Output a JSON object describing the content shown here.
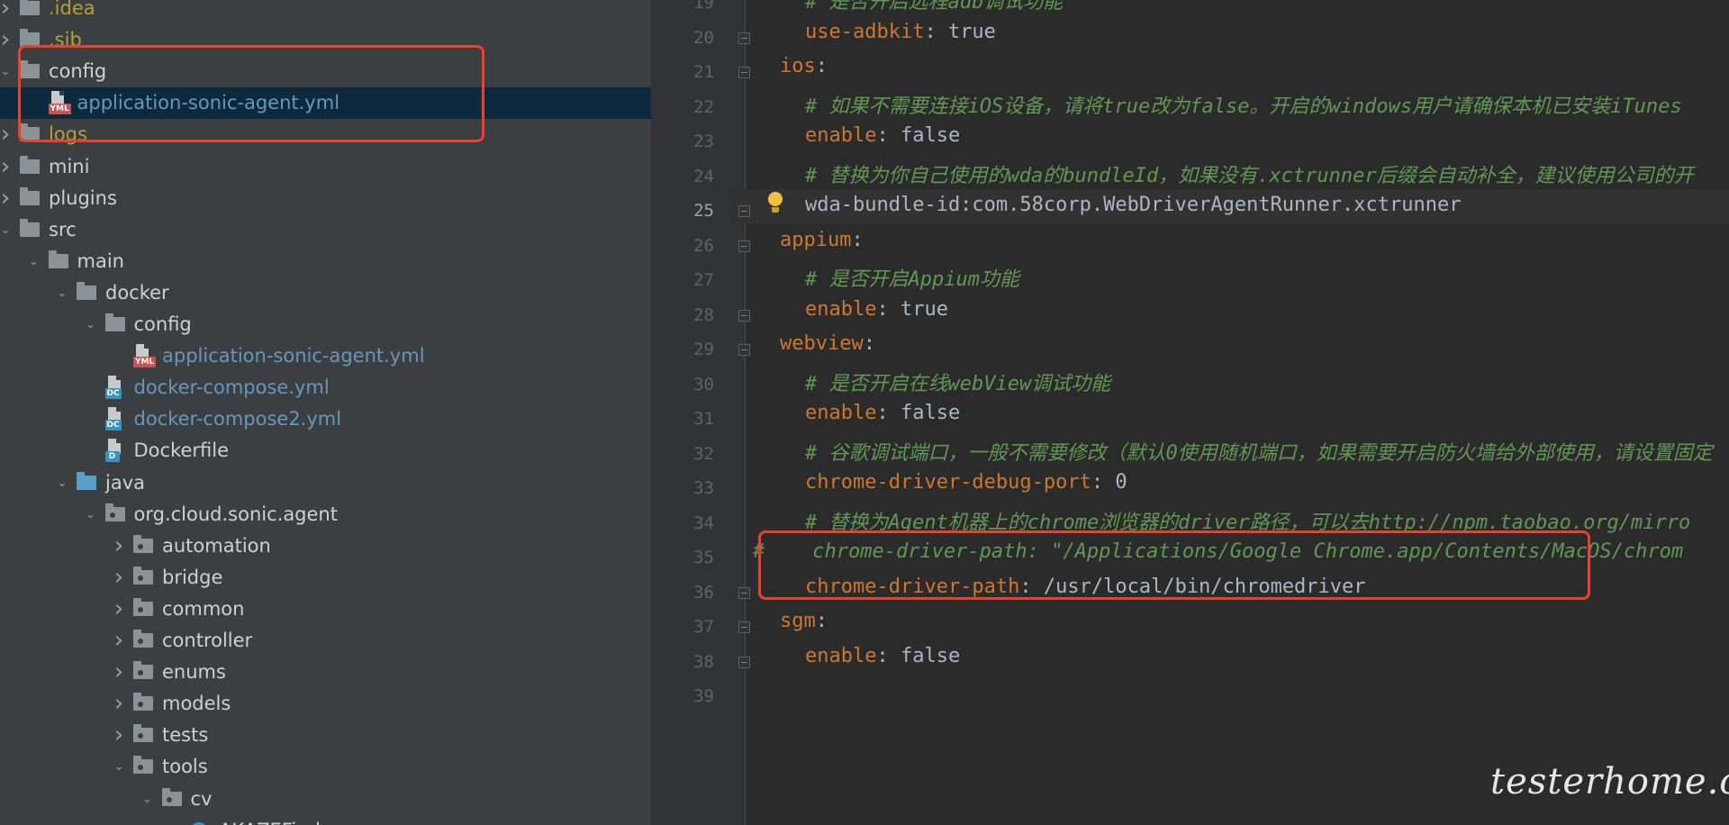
{
  "project_tree": {
    "items": [
      {
        "label": ".idea",
        "icon": "folder-icon",
        "expanded": false,
        "color": "excluded"
      },
      {
        "label": ".sib",
        "icon": "folder-icon",
        "expanded": false,
        "color": "excluded"
      },
      {
        "label": "config",
        "icon": "folder-icon",
        "expanded": true,
        "color": "default"
      },
      {
        "label": "application-sonic-agent.yml",
        "icon": "yml-file-icon",
        "color": "modified",
        "selected": true
      },
      {
        "label": "logs",
        "icon": "folder-icon",
        "expanded": false,
        "color": "excluded"
      },
      {
        "label": "mini",
        "icon": "folder-icon",
        "expanded": false,
        "color": "default"
      },
      {
        "label": "plugins",
        "icon": "folder-icon",
        "expanded": false,
        "color": "default"
      },
      {
        "label": "src",
        "icon": "folder-icon",
        "expanded": true,
        "color": "default"
      },
      {
        "label": "main",
        "icon": "folder-icon",
        "expanded": true,
        "color": "default"
      },
      {
        "label": "docker",
        "icon": "folder-icon",
        "expanded": true,
        "color": "default"
      },
      {
        "label": "config",
        "icon": "folder-icon",
        "expanded": true,
        "color": "default"
      },
      {
        "label": "application-sonic-agent.yml",
        "icon": "yml-file-icon",
        "color": "modified"
      },
      {
        "label": "docker-compose.yml",
        "icon": "docker-compose-file-icon",
        "color": "modified"
      },
      {
        "label": "docker-compose2.yml",
        "icon": "docker-compose-file-icon",
        "color": "modified"
      },
      {
        "label": "Dockerfile",
        "icon": "dockerfile-icon",
        "color": "default"
      },
      {
        "label": "java",
        "icon": "source-folder-icon",
        "expanded": true,
        "color": "default"
      },
      {
        "label": "org.cloud.sonic.agent",
        "icon": "package-icon",
        "expanded": true,
        "color": "default"
      },
      {
        "label": "automation",
        "icon": "package-icon",
        "expanded": false,
        "color": "default"
      },
      {
        "label": "bridge",
        "icon": "package-icon",
        "expanded": false,
        "color": "default"
      },
      {
        "label": "common",
        "icon": "package-icon",
        "expanded": false,
        "color": "default"
      },
      {
        "label": "controller",
        "icon": "package-icon",
        "expanded": false,
        "color": "default"
      },
      {
        "label": "enums",
        "icon": "package-icon",
        "expanded": false,
        "color": "default"
      },
      {
        "label": "models",
        "icon": "package-icon",
        "expanded": false,
        "color": "default"
      },
      {
        "label": "tests",
        "icon": "package-icon",
        "expanded": false,
        "color": "default"
      },
      {
        "label": "tools",
        "icon": "package-icon",
        "expanded": true,
        "color": "default"
      },
      {
        "label": "cv",
        "icon": "package-icon",
        "expanded": true,
        "color": "default"
      },
      {
        "label": "AKAZEFinder",
        "icon": "class-icon",
        "color": "default"
      }
    ]
  },
  "editor": {
    "current_line": "25",
    "lines": [
      {
        "num": "19",
        "tokens": [
          {
            "t": "# 是否开启远程adb调试功能",
            "c": "com"
          }
        ]
      },
      {
        "num": "20",
        "tokens": [
          {
            "t": "use-adbkit",
            "c": "key"
          },
          {
            "t": ": true",
            "c": "val"
          }
        ]
      },
      {
        "num": "21",
        "tokens": [
          {
            "t": "ios",
            "c": "key"
          },
          {
            "t": ":",
            "c": "val"
          }
        ]
      },
      {
        "num": "22",
        "tokens": [
          {
            "t": "# 如果不需要连接iOS设备，请将true改为false。开启的windows用户请确保本机已安装iTunes",
            "c": "com"
          }
        ]
      },
      {
        "num": "23",
        "tokens": [
          {
            "t": "enable",
            "c": "key"
          },
          {
            "t": ": false",
            "c": "val"
          }
        ]
      },
      {
        "num": "24",
        "tokens": [
          {
            "t": "# 替换为你自己使用的wda的bundleId，如果没有.xctrunner后缀会自动补全，建议使用公司的开",
            "c": "com"
          }
        ]
      },
      {
        "num": "25",
        "tokens": [
          {
            "t": "wda-bundle-id:com.58corp.WebDriverAgentRunner.xctrunner",
            "c": "val"
          }
        ]
      },
      {
        "num": "26",
        "tokens": [
          {
            "t": "appium",
            "c": "key"
          },
          {
            "t": ":",
            "c": "val"
          }
        ]
      },
      {
        "num": "27",
        "tokens": [
          {
            "t": "# 是否开启Appium功能",
            "c": "com"
          }
        ]
      },
      {
        "num": "28",
        "tokens": [
          {
            "t": "enable",
            "c": "key"
          },
          {
            "t": ": true",
            "c": "val"
          }
        ]
      },
      {
        "num": "29",
        "tokens": [
          {
            "t": "webview",
            "c": "key"
          },
          {
            "t": ":",
            "c": "val"
          }
        ]
      },
      {
        "num": "30",
        "tokens": [
          {
            "t": "# 是否开启在线webView调试功能",
            "c": "com"
          }
        ]
      },
      {
        "num": "31",
        "tokens": [
          {
            "t": "enable",
            "c": "key"
          },
          {
            "t": ": false",
            "c": "val"
          }
        ]
      },
      {
        "num": "32",
        "tokens": [
          {
            "t": "# 谷歌调试端口，一般不需要修改（默认0使用随机端口，如果需要开启防火墙给外部使用，请设置固定",
            "c": "com"
          }
        ]
      },
      {
        "num": "33",
        "tokens": [
          {
            "t": "chrome-driver-debug-port",
            "c": "key"
          },
          {
            "t": ": 0",
            "c": "val"
          }
        ]
      },
      {
        "num": "34",
        "tokens": [
          {
            "t": "# 替换为Agent机器上的chrome浏览器的driver路径，可以去http://npm.taobao.org/mirro",
            "c": "com"
          }
        ]
      },
      {
        "num": "35",
        "tokens": [
          {
            "t": "#    chrome-driver-path: \"/Applications/Google Chrome.app/Contents/MacOS/chrom",
            "c": "cblock"
          }
        ]
      },
      {
        "num": "36",
        "tokens": [
          {
            "t": "chrome-driver-path",
            "c": "key"
          },
          {
            "t": ": /usr/local/bin/chromedriver",
            "c": "val"
          }
        ]
      },
      {
        "num": "37",
        "tokens": [
          {
            "t": "sgm",
            "c": "key"
          },
          {
            "t": ":",
            "c": "val"
          }
        ]
      },
      {
        "num": "38",
        "tokens": [
          {
            "t": "enable",
            "c": "key"
          },
          {
            "t": ": false",
            "c": "val"
          }
        ]
      },
      {
        "num": "39",
        "tokens": []
      }
    ]
  },
  "watermark": "testerhome.com",
  "colors": {
    "highlight_box": "#e8412c",
    "tree_background": "#3c3f41",
    "editor_background": "#2b2b2b",
    "yaml_key": "#cc7832",
    "yaml_comment": "#629755"
  }
}
